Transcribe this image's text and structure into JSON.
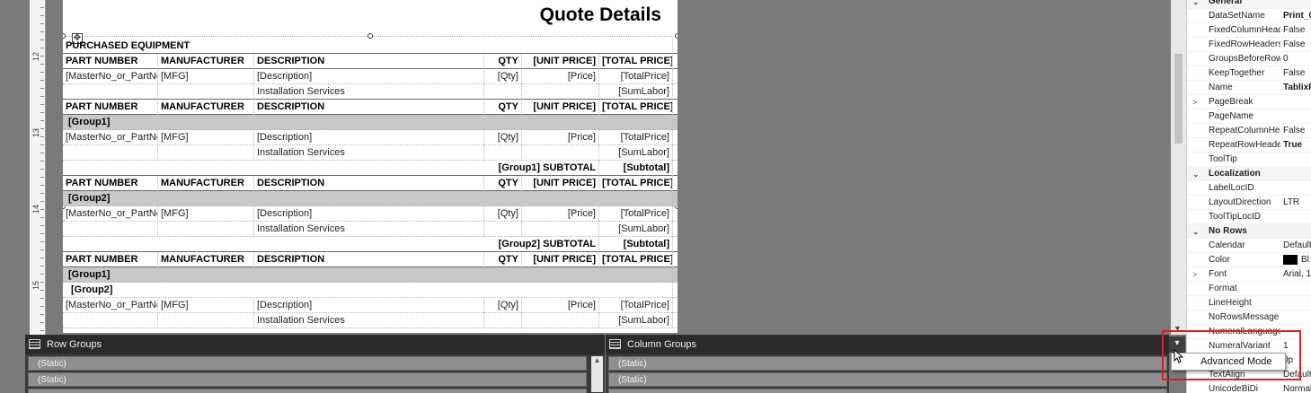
{
  "ruler": {
    "marks": [
      "12",
      "13",
      "14",
      "15"
    ]
  },
  "report": {
    "title": "Quote Details",
    "section_label": "PURCHASED EQUIPMENT",
    "header_cells": [
      "PART NUMBER",
      "MANUFACTURER",
      "DESCRIPTION",
      "QTY",
      "[UNIT PRICE]",
      "[TOTAL PRICE]"
    ],
    "detail_cells": [
      "[MasterNo_or_PartNo]",
      "[MFG]",
      "[Description]",
      "[Qty]",
      "[Price]",
      "[TotalPrice]"
    ],
    "install_cells": [
      "Installation Services",
      "[SumLabor]"
    ],
    "group1_label": "[Group1]",
    "group2_label": "[Group2]",
    "group1_subtotal": "[Group1] SUBTOTAL",
    "group2_subtotal": "[Group2] SUBTOTAL",
    "subtotal_value": "[Subtotal]"
  },
  "properties": {
    "rows": [
      {
        "type": "cat",
        "exp": "⌄",
        "name": "General"
      },
      {
        "name": "DataSetName",
        "value": "Print_C",
        "bold": true
      },
      {
        "name": "FixedColumnHeaders",
        "value": "False"
      },
      {
        "name": "FixedRowHeaders",
        "value": "False"
      },
      {
        "name": "GroupsBeforeRowHeaders",
        "value": "0"
      },
      {
        "name": "KeepTogether",
        "value": "False"
      },
      {
        "name": "Name",
        "value": "TablixF",
        "bold": true
      },
      {
        "name": "PageBreak",
        "value": "",
        "exp": ">"
      },
      {
        "name": "PageName",
        "value": ""
      },
      {
        "name": "RepeatColumnHeaders",
        "value": "False"
      },
      {
        "name": "RepeatRowHeaders",
        "value": "True",
        "bold": true
      },
      {
        "name": "ToolTip",
        "value": ""
      },
      {
        "type": "cat",
        "exp": "⌄",
        "name": "Localization"
      },
      {
        "name": "LabelLocID",
        "value": ""
      },
      {
        "name": "LayoutDirection",
        "value": "LTR"
      },
      {
        "name": "ToolTipLocID",
        "value": ""
      },
      {
        "type": "cat",
        "exp": "⌄",
        "name": "No Rows"
      },
      {
        "name": "Calendar",
        "value": "Default"
      },
      {
        "name": "Color",
        "value": "Bl",
        "swatch": "#000000"
      },
      {
        "name": "Font",
        "value": "Arial, 1",
        "exp": ">"
      },
      {
        "name": "Format",
        "value": ""
      },
      {
        "name": "LineHeight",
        "value": ""
      },
      {
        "name": "NoRowsMessage",
        "value": ""
      },
      {
        "name": "NumeralLanguage",
        "value": ""
      },
      {
        "name": "NumeralVariant",
        "value": "1"
      },
      {
        "name": "Padding",
        "value": "0p"
      },
      {
        "name": "TextAlign",
        "value": "Default"
      },
      {
        "name": "UnicodeBiDi",
        "value": "Normal"
      }
    ]
  },
  "row_groups": {
    "title": "Row Groups",
    "items": [
      "(Static)",
      "(Static)"
    ]
  },
  "column_groups": {
    "title": "Column Groups",
    "items": [
      "(Static)",
      "(Static)"
    ]
  },
  "dropdown": {
    "button_glyph": "▾",
    "item": "Advanced Mode"
  },
  "colors": {
    "highlight": "#e02020",
    "group_band": "#c8c8c8"
  }
}
